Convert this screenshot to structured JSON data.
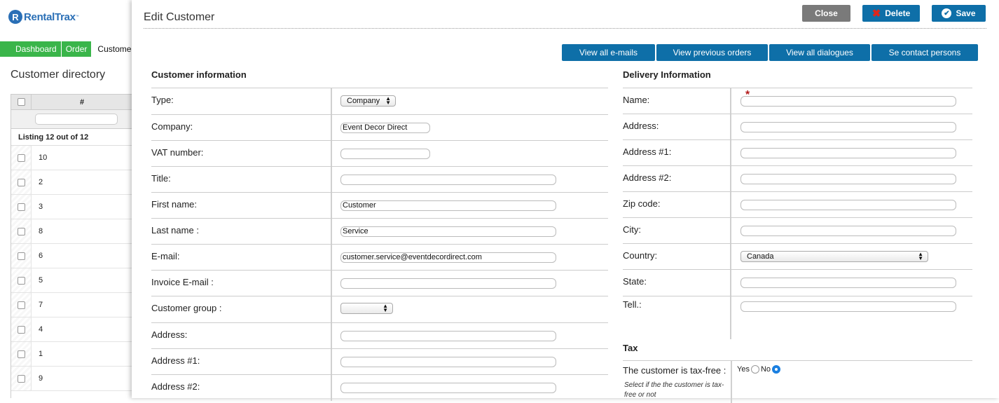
{
  "app": {
    "logo_text": "RentalTrax",
    "logo_tm": "™",
    "logo_mark": "R"
  },
  "nav": {
    "dashboard": "Dashboard",
    "order": "Order",
    "customers": "Customers"
  },
  "directory": {
    "title": "Customer directory",
    "col_hash": "#",
    "listing": "Listing 12 out of 12",
    "rows": [
      "10",
      "2",
      "3",
      "8",
      "6",
      "5",
      "7",
      "4",
      "1",
      "9"
    ]
  },
  "modal": {
    "title": "Edit Customer",
    "buttons": {
      "close": "Close",
      "delete": "Delete",
      "save": "Save"
    },
    "actions": {
      "emails": "View all e-mails",
      "orders": "View previous orders",
      "dialogues": "View all dialogues",
      "contacts": "Se contact persons"
    }
  },
  "customer_info": {
    "title": "Customer information",
    "type_label": "Type:",
    "type_value": "Company",
    "company_label": "Company:",
    "company_value": "Event Decor Direct",
    "vat_label": "VAT number:",
    "vat_value": "",
    "title_label": "Title:",
    "title_value": "",
    "first_label": "First name:",
    "first_value": "Customer",
    "last_label": "Last name :",
    "last_value": "Service",
    "email_label": "E-mail:",
    "email_value": "customer.service@eventdecordirect.com",
    "invoice_label": "Invoice E-mail :",
    "invoice_value": "",
    "group_label": "Customer group :",
    "group_value": "",
    "address_label": "Address:",
    "address1_label": "Address #1:",
    "address2_label": "Address #2:"
  },
  "delivery_info": {
    "title": "Delivery Information",
    "required_mark": "*",
    "name_label": "Name:",
    "address_label": "Address:",
    "address1_label": "Address #1:",
    "address2_label": "Address #2:",
    "zip_label": "Zip code:",
    "city_label": "City:",
    "country_label": "Country:",
    "country_value": "Canada",
    "state_label": "State:",
    "tel_label": "Tell.:"
  },
  "tax": {
    "title": "Tax",
    "label": "The customer is tax-free :",
    "yes": "Yes",
    "no": "No",
    "selected": "No",
    "hint": "Select if the the customer is tax-free or not"
  },
  "colors": {
    "primary": "#0e6fa8",
    "nav_green": "#3ab54a",
    "close_gray": "#7a7a7a",
    "required_red": "#b31b1b"
  }
}
